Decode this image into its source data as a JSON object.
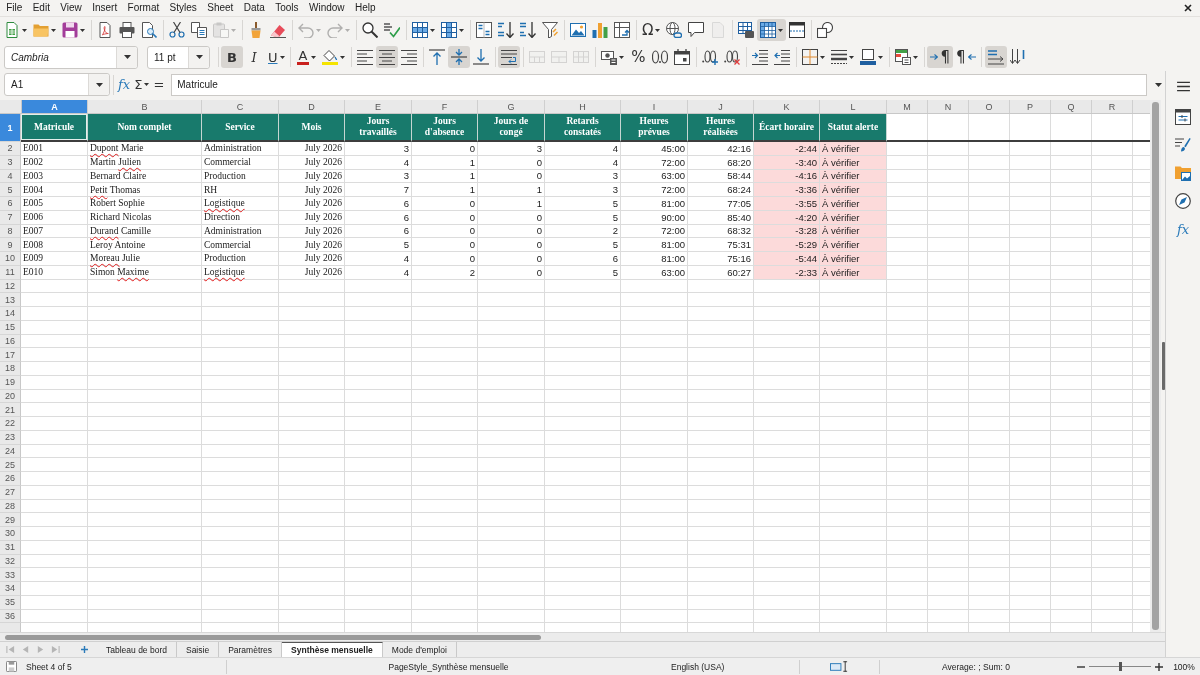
{
  "menu_bar": {
    "items": [
      "File",
      "Edit",
      "View",
      "Insert",
      "Format",
      "Styles",
      "Sheet",
      "Data",
      "Tools",
      "Window",
      "Help"
    ]
  },
  "standard_toolbar": {
    "paste": {
      "disabled": true
    },
    "undo": {
      "disabled": true
    },
    "redo": {
      "disabled": true
    },
    "special_character": {
      "label": "Ω"
    },
    "header_footer": {
      "disabled": true
    },
    "freeze_rows_columns": {
      "on": true
    }
  },
  "formatting_toolbar": {
    "font_name": "Cambria",
    "font_size": "11 pt",
    "bold": {
      "label": "B",
      "on": true
    },
    "italic": {
      "label": "I",
      "on": false
    },
    "underline": {
      "label": "U",
      "on": false
    },
    "font_color": {
      "label": "A"
    },
    "align_left": {
      "on": false
    },
    "align_center": {
      "on": true
    },
    "align_right": {
      "on": false
    },
    "align_top": {
      "on": false
    },
    "align_middle": {
      "on": true
    },
    "align_bottom": {
      "on": false
    },
    "wrap_text": {
      "on": true
    },
    "merge_and_center": {
      "disabled": true
    },
    "merge_cells": {
      "disabled": true
    },
    "unmerge_cells": {
      "disabled": true
    },
    "percent": {
      "label": "%"
    },
    "paragraph_left_to_right": {
      "label": "¶",
      "on": true
    },
    "paragraph_right_to_left": {
      "label": "¶",
      "on": false
    },
    "text_left_to_right": {
      "on": true
    },
    "text_vertical": {
      "on": false
    }
  },
  "formula_bar": {
    "name_box": "A1",
    "function_wizard": "fx",
    "sum": "Σ",
    "equals": "=",
    "content": "Matricule"
  },
  "sidebar": {
    "functions": "fx"
  },
  "sheet": {
    "columns": [
      {
        "label": "A",
        "selected": true
      },
      {
        "label": "B",
        "selected": false
      },
      {
        "label": "C",
        "selected": false
      },
      {
        "label": "D",
        "selected": false
      },
      {
        "label": "E",
        "selected": false
      },
      {
        "label": "F",
        "selected": false
      },
      {
        "label": "G",
        "selected": false
      },
      {
        "label": "H",
        "selected": false
      },
      {
        "label": "I",
        "selected": false
      },
      {
        "label": "J",
        "selected": false
      },
      {
        "label": "K",
        "selected": false
      },
      {
        "label": "L",
        "selected": false
      },
      {
        "label": "M",
        "selected": false
      },
      {
        "label": "N",
        "selected": false
      },
      {
        "label": "O",
        "selected": false
      },
      {
        "label": "P",
        "selected": false
      },
      {
        "label": "Q",
        "selected": false
      },
      {
        "label": "R",
        "selected": false
      }
    ],
    "row_headers": [
      {
        "label": "1",
        "selected": true
      },
      {
        "label": "2",
        "selected": false
      },
      {
        "label": "3",
        "selected": false
      },
      {
        "label": "4",
        "selected": false
      },
      {
        "label": "5",
        "selected": false
      },
      {
        "label": "6",
        "selected": false
      },
      {
        "label": "7",
        "selected": false
      },
      {
        "label": "8",
        "selected": false
      },
      {
        "label": "9",
        "selected": false
      },
      {
        "label": "10",
        "selected": false
      },
      {
        "label": "11",
        "selected": false
      },
      {
        "label": "12",
        "selected": false
      },
      {
        "label": "13",
        "selected": false
      },
      {
        "label": "14",
        "selected": false
      },
      {
        "label": "15",
        "selected": false
      },
      {
        "label": "16",
        "selected": false
      },
      {
        "label": "17",
        "selected": false
      },
      {
        "label": "18",
        "selected": false
      },
      {
        "label": "19",
        "selected": false
      },
      {
        "label": "20",
        "selected": false
      },
      {
        "label": "21",
        "selected": false
      },
      {
        "label": "22",
        "selected": false
      },
      {
        "label": "23",
        "selected": false
      },
      {
        "label": "24",
        "selected": false
      },
      {
        "label": "25",
        "selected": false
      },
      {
        "label": "26",
        "selected": false
      },
      {
        "label": "27",
        "selected": false
      },
      {
        "label": "28",
        "selected": false
      },
      {
        "label": "29",
        "selected": false
      },
      {
        "label": "30",
        "selected": false
      },
      {
        "label": "31",
        "selected": false
      },
      {
        "label": "32",
        "selected": false
      },
      {
        "label": "33",
        "selected": false
      },
      {
        "label": "34",
        "selected": false
      },
      {
        "label": "35",
        "selected": false
      },
      {
        "label": "36",
        "selected": false
      }
    ],
    "header_cells": [
      {
        "text": "Matricule",
        "selected": true
      },
      {
        "text": "Nom complet",
        "selected": false
      },
      {
        "text": "Service",
        "selected": false
      },
      {
        "text": "Mois",
        "selected": false
      },
      {
        "text": "Jours travaillés",
        "selected": false
      },
      {
        "text": "Jours d'absence",
        "selected": false
      },
      {
        "text": "Jours de congé",
        "selected": false
      },
      {
        "text": "Retards constatés",
        "selected": false
      },
      {
        "text": "Heures prévues",
        "selected": false
      },
      {
        "text": "Heures réalisées",
        "selected": false
      },
      {
        "text": "Écart horaire",
        "selected": false
      },
      {
        "text": "Statut alerte",
        "selected": false
      }
    ],
    "rows": [
      {
        "id": "E001",
        "name": [
          {
            "text": "Dupont",
            "misspelled": true
          },
          {
            "text": "Marie",
            "misspelled": false
          }
        ],
        "service": [
          {
            "text": "Administration",
            "misspelled": false
          }
        ],
        "month": "July 2026",
        "days_worked": "3",
        "days_absent": "0",
        "days_leave": "3",
        "late_arrivals": "4",
        "planned_hours": "45:00",
        "actual_hours": "42:16",
        "hour_gap": "-2:44",
        "alert_status": "À vérifier",
        "alert": true
      },
      {
        "id": "E002",
        "name": [
          {
            "text": "Martin",
            "misspelled": false
          },
          {
            "text": "Julien",
            "misspelled": true
          }
        ],
        "service": [
          {
            "text": "Commercial",
            "misspelled": false
          }
        ],
        "month": "July 2026",
        "days_worked": "4",
        "days_absent": "1",
        "days_leave": "0",
        "late_arrivals": "4",
        "planned_hours": "72:00",
        "actual_hours": "68:20",
        "hour_gap": "-3:40",
        "alert_status": "À vérifier",
        "alert": true
      },
      {
        "id": "E003",
        "name": [
          {
            "text": "Bernard",
            "misspelled": false
          },
          {
            "text": "Claire",
            "misspelled": false
          }
        ],
        "service": [
          {
            "text": "Production",
            "misspelled": false
          }
        ],
        "month": "July 2026",
        "days_worked": "3",
        "days_absent": "1",
        "days_leave": "0",
        "late_arrivals": "3",
        "planned_hours": "63:00",
        "actual_hours": "58:44",
        "hour_gap": "-4:16",
        "alert_status": "À vérifier",
        "alert": true
      },
      {
        "id": "E004",
        "name": [
          {
            "text": "Petit",
            "misspelled": true
          },
          {
            "text": "Thomas",
            "misspelled": false
          }
        ],
        "service": [
          {
            "text": "RH",
            "misspelled": false
          }
        ],
        "month": "July 2026",
        "days_worked": "7",
        "days_absent": "1",
        "days_leave": "1",
        "late_arrivals": "3",
        "planned_hours": "72:00",
        "actual_hours": "68:24",
        "hour_gap": "-3:36",
        "alert_status": "À vérifier",
        "alert": true
      },
      {
        "id": "E005",
        "name": [
          {
            "text": "Robert",
            "misspelled": false
          },
          {
            "text": "Sophie",
            "misspelled": false
          }
        ],
        "service": [
          {
            "text": "Logistique",
            "misspelled": true
          }
        ],
        "month": "July 2026",
        "days_worked": "6",
        "days_absent": "0",
        "days_leave": "1",
        "late_arrivals": "5",
        "planned_hours": "81:00",
        "actual_hours": "77:05",
        "hour_gap": "-3:55",
        "alert_status": "À vérifier",
        "alert": true
      },
      {
        "id": "E006",
        "name": [
          {
            "text": "Richard",
            "misspelled": false
          },
          {
            "text": "Nicolas",
            "misspelled": false
          }
        ],
        "service": [
          {
            "text": "Direction",
            "misspelled": false
          }
        ],
        "month": "July 2026",
        "days_worked": "6",
        "days_absent": "0",
        "days_leave": "0",
        "late_arrivals": "5",
        "planned_hours": "90:00",
        "actual_hours": "85:40",
        "hour_gap": "-4:20",
        "alert_status": "À vérifier",
        "alert": true
      },
      {
        "id": "E007",
        "name": [
          {
            "text": "Durand",
            "misspelled": true
          },
          {
            "text": "Camille",
            "misspelled": false
          }
        ],
        "service": [
          {
            "text": "Administration",
            "misspelled": false
          }
        ],
        "month": "July 2026",
        "days_worked": "6",
        "days_absent": "0",
        "days_leave": "0",
        "late_arrivals": "2",
        "planned_hours": "72:00",
        "actual_hours": "68:32",
        "hour_gap": "-3:28",
        "alert_status": "À vérifier",
        "alert": true
      },
      {
        "id": "E008",
        "name": [
          {
            "text": "Leroy",
            "misspelled": false
          },
          {
            "text": "Antoine",
            "misspelled": false
          }
        ],
        "service": [
          {
            "text": "Commercial",
            "misspelled": false
          }
        ],
        "month": "July 2026",
        "days_worked": "5",
        "days_absent": "0",
        "days_leave": "0",
        "late_arrivals": "5",
        "planned_hours": "81:00",
        "actual_hours": "75:31",
        "hour_gap": "-5:29",
        "alert_status": "À vérifier",
        "alert": true
      },
      {
        "id": "E009",
        "name": [
          {
            "text": "Moreau",
            "misspelled": true
          },
          {
            "text": "Julie",
            "misspelled": false
          }
        ],
        "service": [
          {
            "text": "Production",
            "misspelled": false
          }
        ],
        "month": "July 2026",
        "days_worked": "4",
        "days_absent": "0",
        "days_leave": "0",
        "late_arrivals": "6",
        "planned_hours": "81:00",
        "actual_hours": "75:16",
        "hour_gap": "-5:44",
        "alert_status": "À vérifier",
        "alert": true
      },
      {
        "id": "E010",
        "name": [
          {
            "text": "Simon",
            "misspelled": false
          },
          {
            "text": "Maxime",
            "misspelled": true
          }
        ],
        "service": [
          {
            "text": "Logistique",
            "misspelled": true
          }
        ],
        "month": "July 2026",
        "days_worked": "4",
        "days_absent": "2",
        "days_leave": "0",
        "late_arrivals": "5",
        "planned_hours": "63:00",
        "actual_hours": "60:27",
        "hour_gap": "-2:33",
        "alert_status": "À vérifier",
        "alert": true
      }
    ]
  },
  "tab_scroll_buttons": [
    {
      "disabled": true
    },
    {
      "disabled": true
    },
    {
      "disabled": true
    },
    {
      "disabled": true
    }
  ],
  "sheet_tabs": [
    {
      "label": "Tableau de bord",
      "selected": false
    },
    {
      "label": "Saisie",
      "selected": false
    },
    {
      "label": "Paramètres",
      "selected": false
    },
    {
      "label": "Synthèse mensuelle",
      "selected": true
    },
    {
      "label": "Mode d'emploi",
      "selected": false
    }
  ],
  "status_bar": {
    "sheet_position": "Sheet 4 of 5",
    "page_style": "PageStyle_Synthèse mensuelle",
    "language": "English (USA)",
    "selection_summary": "Average: ; Sum: 0",
    "zoom": {
      "level": 0.5,
      "reading": "100%"
    }
  }
}
